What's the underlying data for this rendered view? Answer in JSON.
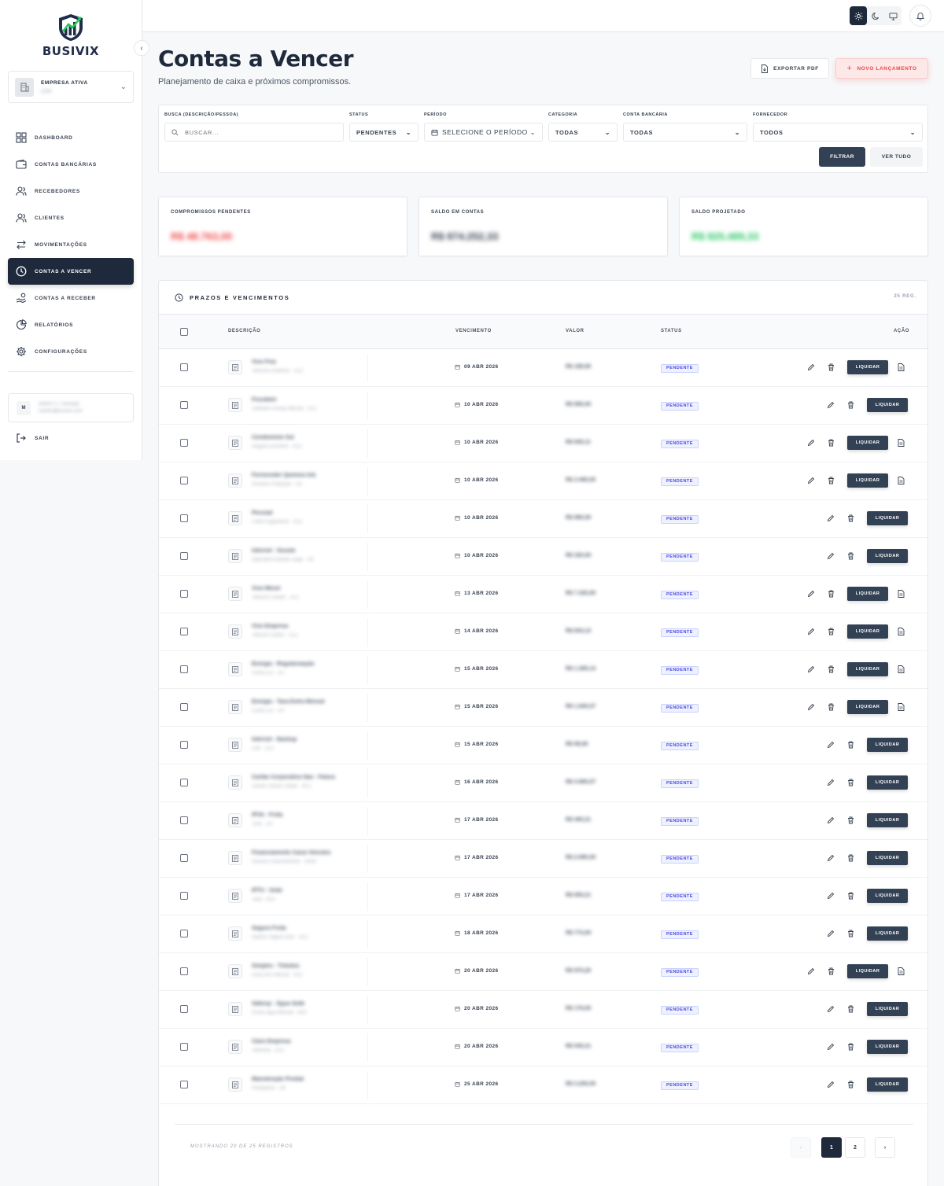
{
  "brand": {
    "name": "BUSIVIX"
  },
  "company": {
    "label": "EMPRESA ATIVA",
    "name": "LDA"
  },
  "nav": [
    {
      "label": "DASHBOARD",
      "icon": "grid-icon",
      "active": false
    },
    {
      "label": "CONTAS BANCÁRIAS",
      "icon": "wallet-icon",
      "active": false
    },
    {
      "label": "RECEBEDORES",
      "icon": "users-icon",
      "active": false
    },
    {
      "label": "CLIENTES",
      "icon": "users-icon",
      "active": false
    },
    {
      "label": "MOVIMENTAÇÕES",
      "icon": "arrows-icon",
      "active": false
    },
    {
      "label": "CONTAS A VENCER",
      "icon": "clock-icon",
      "active": true
    },
    {
      "label": "CONTAS A RECEBER",
      "icon": "hand-coins-icon",
      "active": false
    },
    {
      "label": "RELATÓRIOS",
      "icon": "pie-chart-icon",
      "active": false
    },
    {
      "label": "CONFIGURAÇÕES",
      "icon": "gear-icon",
      "active": false
    }
  ],
  "user": {
    "initial": "M",
    "name": "Martim S. Camargo",
    "email": "martim@busivix.com"
  },
  "logout": {
    "label": "SAIR"
  },
  "header": {
    "title": "Contas a Vencer",
    "subtitle": "Planejamento de caixa e próximos compromissos.",
    "export_label": "EXPORTAR PDF",
    "new_label": "NOVO LANÇAMENTO"
  },
  "filters": {
    "search": {
      "label": "BUSCA (DESCRIÇÃO/PESSOA)",
      "placeholder": "BUSCAR..."
    },
    "status": {
      "label": "STATUS",
      "value": "PENDENTES"
    },
    "period": {
      "label": "PERÍODO",
      "value": "SELECIONE O PERÍODO"
    },
    "category": {
      "label": "CATEGORIA",
      "value": "TODAS"
    },
    "account": {
      "label": "CONTA BANCÁRIA",
      "value": "TODAS"
    },
    "supplier": {
      "label": "FORNECEDOR",
      "value": "TODOS"
    },
    "filter_label": "FILTRAR",
    "all_label": "VER TUDO"
  },
  "cards": [
    {
      "label": "COMPROMISSOS PENDENTES",
      "value": "R$ 48.763,00",
      "color": "#ef4444"
    },
    {
      "label": "SALDO EM CONTAS",
      "value": "R$ 874.252,33",
      "color": "#374151"
    },
    {
      "label": "SALDO PROJETADO",
      "value": "R$ 825.489,33",
      "color": "#22c55e"
    }
  ],
  "table": {
    "title": "PRAZOS E VENCIMENTOS",
    "count": "25 REG.",
    "columns": {
      "description": "DESCRIÇÃO",
      "due": "VENCIMENTO",
      "value": "VALOR",
      "status": "STATUS",
      "action": "AÇÃO"
    },
    "action_label": "LIQUIDAR",
    "rows": [
      {
        "desc": "Vivo Fixa",
        "sub": "Telecom Empresa · 1/12",
        "due": "09 ABR 2026",
        "value": "R$ 189,90",
        "status": "PENDENTE",
        "attach": true
      },
      {
        "desc": "Fiscalwin",
        "sub": "Software Gestão Mensal · 3/12",
        "due": "10 ABR 2026",
        "value": "R$ 890,00",
        "status": "PENDENTE",
        "attach": false
      },
      {
        "desc": "Condomínio Sul",
        "sub": "Aluguel Escritório · 4/12",
        "due": "10 ABR 2026",
        "value": "R$ 845,11",
        "status": "PENDENTE",
        "attach": true
      },
      {
        "desc": "Fornecedor Química Ind.",
        "sub": "Insumos Produção · 2/6",
        "due": "10 ABR 2026",
        "value": "R$ 3.460,00",
        "status": "PENDENTE",
        "attach": true
      },
      {
        "desc": "Pessoal",
        "sub": "Folha Pagamento · 4/12",
        "due": "10 ABR 2026",
        "value": "R$ 980,00",
        "status": "PENDENTE",
        "attach": false
      },
      {
        "desc": "Internet - Sicoob",
        "sub": "Operadora Banda Larga · 1/6",
        "due": "10 ABR 2026",
        "value": "R$ 320,00",
        "status": "PENDENTE",
        "attach": false
      },
      {
        "desc": "Vivo Móvel",
        "sub": "Telecom Celular · 2/12",
        "due": "13 ABR 2026",
        "value": "R$ 7.320,00",
        "status": "PENDENTE",
        "attach": true
      },
      {
        "desc": "Vivo Empresa",
        "sub": "Telecom Dados · 1/12",
        "due": "14 ABR 2026",
        "value": "R$ 834,12",
        "status": "PENDENTE",
        "attach": true
      },
      {
        "desc": "Energia - Regularização",
        "sub": "Conta Luz · 1/3",
        "due": "15 ABR 2026",
        "value": "R$ 1.280,14",
        "status": "PENDENTE",
        "attach": true
      },
      {
        "desc": "Energia - Taxa Extra Mensal",
        "sub": "Conta Luz · 2/3",
        "due": "15 ABR 2026",
        "value": "R$ 1.840,07",
        "status": "PENDENTE",
        "attach": true
      },
      {
        "desc": "Internet - Backup",
        "sub": "Link · 1/12",
        "due": "15 ABR 2026",
        "value": "R$ 99,90",
        "status": "PENDENTE",
        "attach": false
      },
      {
        "desc": "Cartão Corporativo Itaú - Fatura",
        "sub": "Gastos Gerais Cartão · 4/12",
        "due": "16 ABR 2026",
        "value": "R$ 4.860,07",
        "status": "PENDENTE",
        "attach": false
      },
      {
        "desc": "IPVA - Frota",
        "sub": "Taxa · 1/3",
        "due": "17 ABR 2026",
        "value": "R$ 460,21",
        "status": "PENDENTE",
        "attach": false
      },
      {
        "desc": "Financiamento Caixa Veículos",
        "sub": "Parcela Financiamento · 14/48",
        "due": "17 ABR 2026",
        "value": "R$ 2.890,00",
        "status": "PENDENTE",
        "attach": false
      },
      {
        "desc": "IPTU - Sede",
        "sub": "Taxa · 4/10",
        "due": "17 ABR 2026",
        "value": "R$ 650,21",
        "status": "PENDENTE",
        "attach": false
      },
      {
        "desc": "Seguro Frota",
        "sub": "Apólice Seguro Auto · 3/12",
        "due": "18 ABR 2026",
        "value": "R$ 774,00",
        "status": "PENDENTE",
        "attach": false
      },
      {
        "desc": "Simples - Tributos",
        "sub": "Guia DAS Mensal · 4/12",
        "due": "20 ABR 2026",
        "value": "R$ 970,20",
        "status": "PENDENTE",
        "attach": true
      },
      {
        "desc": "Sabesp - Água Sede",
        "sub": "Conta Água Mensal · 4/12",
        "due": "20 ABR 2026",
        "value": "R$ 179,00",
        "status": "PENDENTE",
        "attach": false
      },
      {
        "desc": "Claro Empresa",
        "sub": "Telefonia · 2/12",
        "due": "20 ABR 2026",
        "value": "R$ 540,21",
        "status": "PENDENTE",
        "attach": false
      },
      {
        "desc": "Manutenção Predial",
        "sub": "Prestadora · 1/6",
        "due": "25 ABR 2026",
        "value": "R$ 3.200,00",
        "status": "PENDENTE",
        "attach": false
      }
    ]
  },
  "pagination": {
    "info": "MOSTRANDO 20 DE 25 REGISTROS",
    "pages": [
      "1",
      "2"
    ],
    "current": "1"
  }
}
